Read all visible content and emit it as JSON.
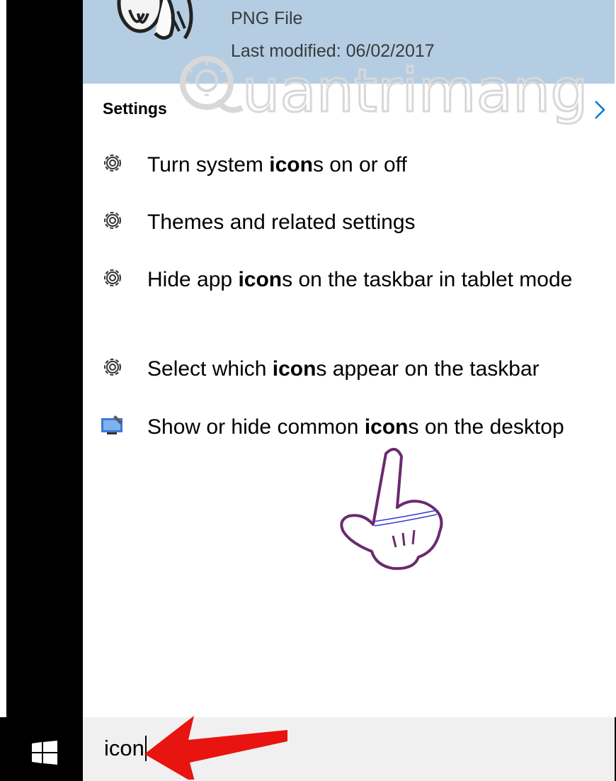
{
  "top_result": {
    "file_type": "PNG File",
    "last_modified": "Last modified: 06/02/2017"
  },
  "watermark": {
    "text": "Quantrimang"
  },
  "section": {
    "title": "Settings"
  },
  "results": [
    {
      "pre": "Turn system ",
      "bold": "icon",
      "post": "s on or off",
      "icon": "gear-icon"
    },
    {
      "pre": "Themes and related settings",
      "bold": "",
      "post": "",
      "icon": "gear-icon"
    },
    {
      "pre": "Hide app ",
      "bold": "icon",
      "post": "s on the taskbar in tablet mode",
      "icon": "gear-icon"
    },
    {
      "pre": "Select which ",
      "bold": "icon",
      "post": "s appear on the taskbar",
      "icon": "gear-icon"
    },
    {
      "pre": "Show or hide common ",
      "bold": "icon",
      "post": "s on the desktop",
      "icon": "desktop-settings-icon"
    }
  ],
  "search": {
    "query": "icon"
  },
  "colors": {
    "top_result_bg": "#b4cde3",
    "accent_chevron": "#0078d7",
    "annotation_arrow": "#e8140f",
    "pointer_outline": "#6b2a6e"
  }
}
